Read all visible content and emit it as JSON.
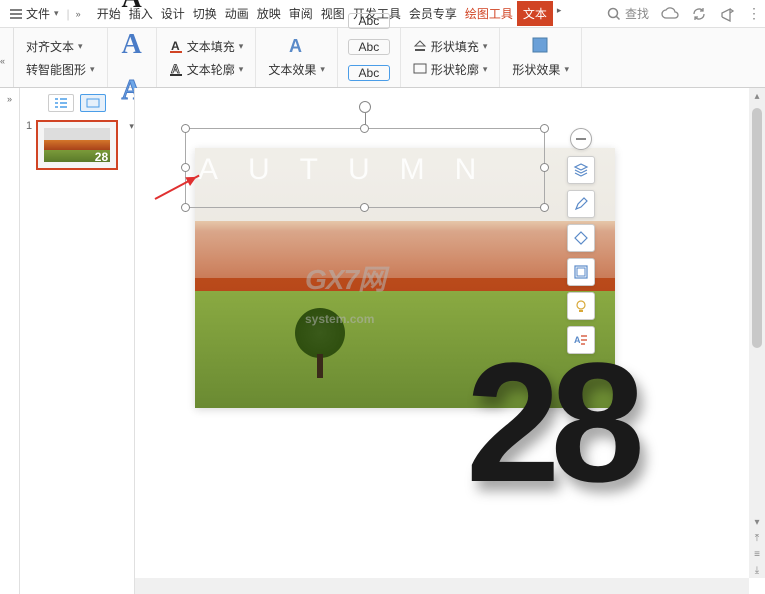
{
  "menubar": {
    "file": "文件",
    "tabs": [
      "开始",
      "插入",
      "设计",
      "切换",
      "动画",
      "放映",
      "审阅",
      "视图",
      "开发工具",
      "会员专享",
      "绘图工具",
      "文本"
    ],
    "active_tab": "绘图工具",
    "highlight_tab": "文本",
    "search": "查找"
  },
  "ribbon": {
    "align_text": "对齐文本",
    "smart_graphic": "转智能图形",
    "wordart_sample": "A",
    "text_fill": "文本填充",
    "text_outline": "文本轮廓",
    "text_effects": "文本效果",
    "abc": "Abc",
    "shape_fill": "形状填充",
    "shape_outline": "形状轮廓",
    "shape_effects": "形状效果"
  },
  "sidebar": {
    "slides": [
      {
        "num": "1",
        "overlay": "28"
      }
    ]
  },
  "canvas": {
    "textbox_text": "AUTUMN",
    "watermark": "GX7",
    "watermark_sub": "system.com",
    "big_number": "28"
  },
  "float_tools": [
    "minus",
    "layers",
    "pen",
    "shape",
    "frame",
    "bulb",
    "text-effect"
  ]
}
